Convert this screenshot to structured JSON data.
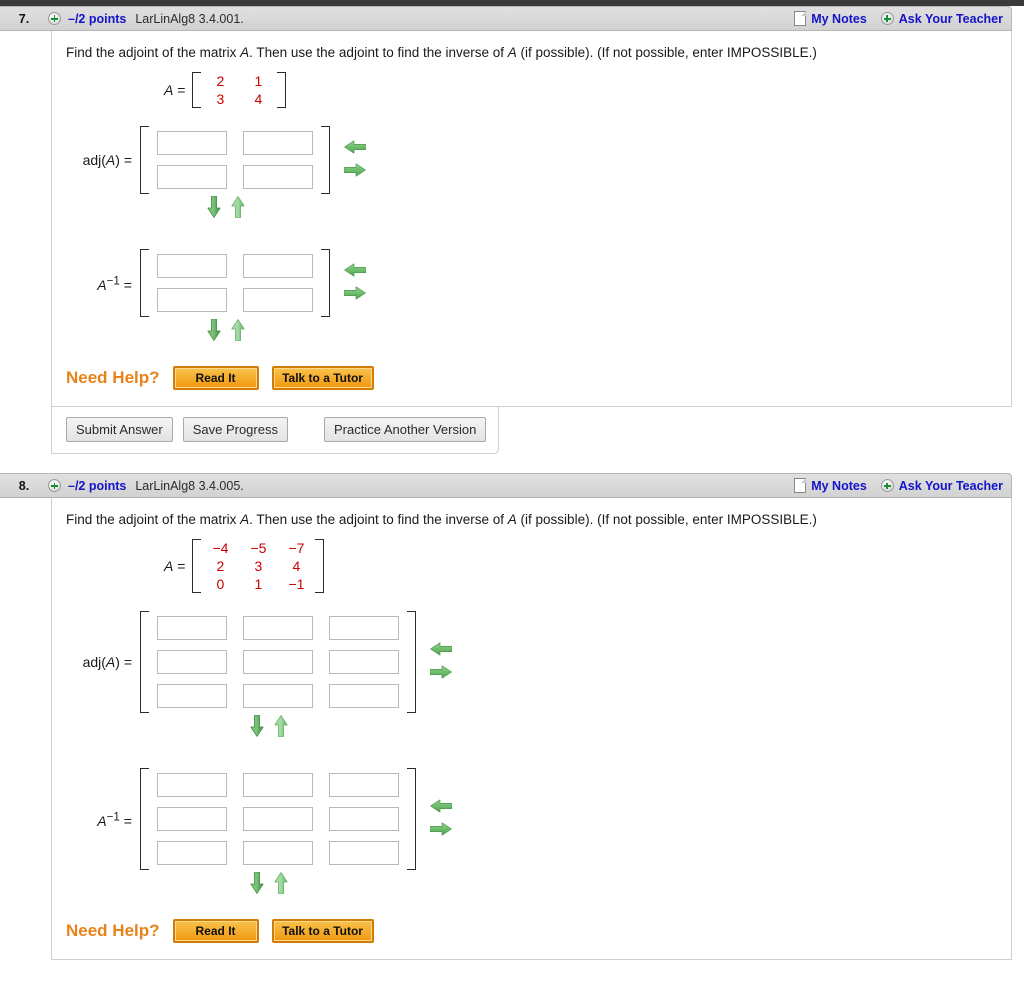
{
  "page": {
    "prompt_text_parts": {
      "p1": "Find the adjoint of the matrix ",
      "a1": "A",
      "p2": ". Then use the adjoint to find the inverse of ",
      "a2": "A",
      "p3": " (if possible). (If not possible, enter IMPOSSIBLE.)"
    },
    "labels": {
      "adj": "adj(",
      "adj_var": "A",
      "adj_close": ") =",
      "inv_var": "A",
      "inv_sup": "−1",
      "inv_eq": " =",
      "a_label": "A",
      "equals": "="
    },
    "header_links": {
      "my_notes": "My Notes",
      "ask_teacher": "Ask Your Teacher"
    },
    "need_help": {
      "title": "Need Help?",
      "read_it": "Read It",
      "talk_tutor": "Talk to a Tutor"
    },
    "submit_row": {
      "submit": "Submit Answer",
      "save": "Save Progress",
      "practice": "Practice Another Version"
    },
    "colors": {
      "matrix_value": "#cc0000",
      "link_blue": "#1414c8",
      "need_help_orange": "#E8821A",
      "arrow_green": "#5aa85a",
      "header_bg": "#d8d8d8"
    },
    "icons": {
      "plus": "plus-circle-icon",
      "note": "note-page-icon",
      "arrow_left": "arrow-left-icon",
      "arrow_right": "arrow-right-icon",
      "arrow_down": "arrow-down-icon",
      "arrow_up": "arrow-up-icon"
    }
  },
  "questions": [
    {
      "number": "7.",
      "points": "–/2 points",
      "code": "LarLinAlg8 3.4.001.",
      "matrix_a": {
        "rows": 2,
        "cols": 2,
        "values": [
          [
            "2",
            "1"
          ],
          [
            "3",
            "4"
          ]
        ]
      },
      "adj_input": {
        "rows": 2,
        "cols": 2,
        "values": [
          [
            "",
            ""
          ],
          [
            "",
            ""
          ]
        ]
      },
      "inv_input": {
        "rows": 2,
        "cols": 2,
        "values": [
          [
            "",
            ""
          ],
          [
            "",
            ""
          ]
        ]
      },
      "has_submit_row": true
    },
    {
      "number": "8.",
      "points": "–/2 points",
      "code": "LarLinAlg8 3.4.005.",
      "matrix_a": {
        "rows": 3,
        "cols": 3,
        "values": [
          [
            "−4",
            "−5",
            "−7"
          ],
          [
            "2",
            "3",
            "4"
          ],
          [
            "0",
            "1",
            "−1"
          ]
        ]
      },
      "adj_input": {
        "rows": 3,
        "cols": 3,
        "values": [
          [
            "",
            "",
            ""
          ],
          [
            "",
            "",
            ""
          ],
          [
            "",
            "",
            ""
          ]
        ]
      },
      "inv_input": {
        "rows": 3,
        "cols": 3,
        "values": [
          [
            "",
            "",
            ""
          ],
          [
            "",
            "",
            ""
          ],
          [
            "",
            "",
            ""
          ]
        ]
      },
      "has_submit_row": false
    }
  ]
}
